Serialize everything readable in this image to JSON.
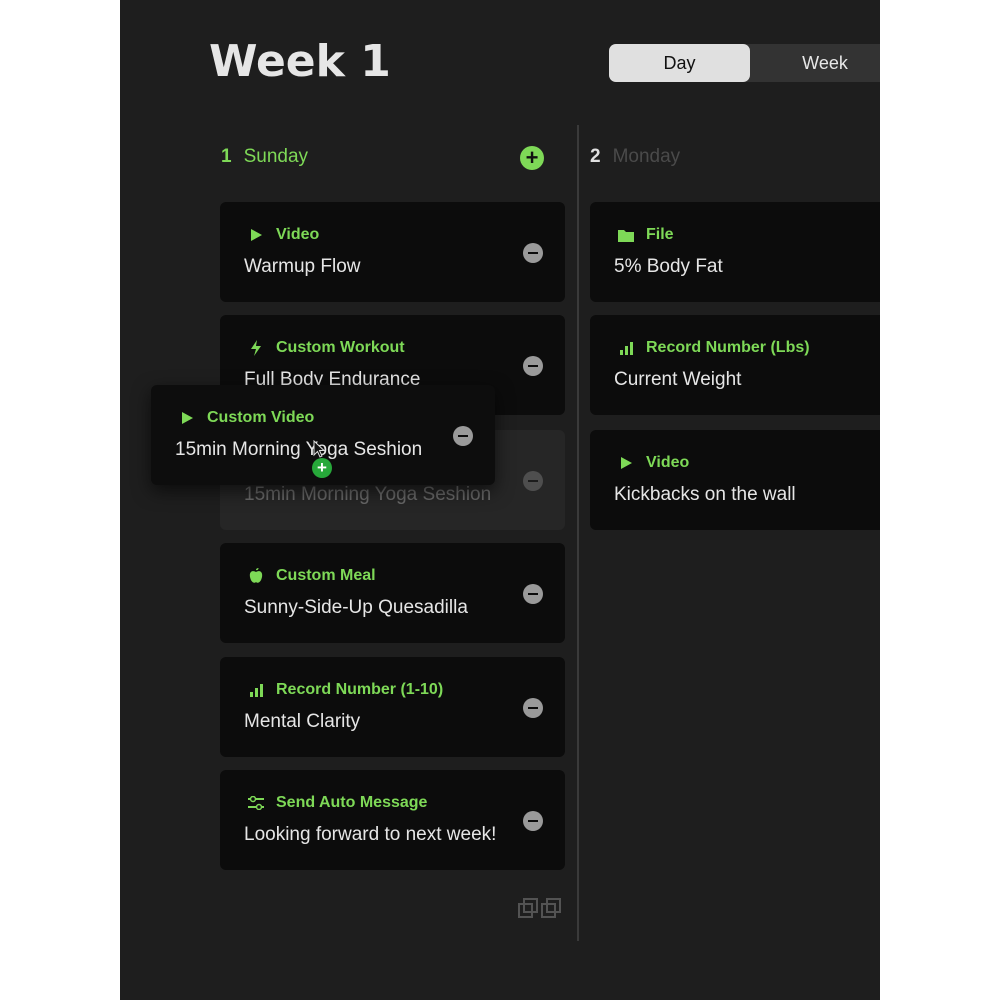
{
  "header": {
    "title": "Week 1"
  },
  "view_toggle": {
    "day": "Day",
    "week": "Week"
  },
  "days": [
    {
      "num": "1",
      "name": "Sunday"
    },
    {
      "num": "2",
      "name": "Monday"
    }
  ],
  "sunday_cards": [
    {
      "type": "Video",
      "icon": "play-icon",
      "label": "Warmup Flow"
    },
    {
      "type": "Custom Workout",
      "icon": "lightning-icon",
      "label": "Full Body Endurance"
    },
    {
      "type": "Custom Video",
      "icon": "play-icon",
      "label": "15min Morning Yoga Seshion"
    },
    {
      "type": "Custom Meal",
      "icon": "apple-icon",
      "label": "Sunny-Side-Up Quesadilla"
    },
    {
      "type": "Record Number (1-10)",
      "icon": "bar-chart-icon",
      "label": "Mental Clarity"
    },
    {
      "type": "Send Auto Message",
      "icon": "sliders-icon",
      "label": "Looking forward to next week!"
    }
  ],
  "monday_cards": [
    {
      "type": "File",
      "icon": "folder-icon",
      "label": "5% Body Fat"
    },
    {
      "type": "Record Number (Lbs)",
      "icon": "bar-chart-icon",
      "label": "Current Weight"
    },
    {
      "type": "Video",
      "icon": "play-icon",
      "label": "Kickbacks on the wall"
    }
  ],
  "dragging_card": {
    "type": "Custom Video",
    "icon": "play-icon",
    "label": "15min Morning Yoga Seshion"
  },
  "colors": {
    "accent": "#7ed957",
    "background": "#1e1e1e",
    "card": "#0c0c0c"
  }
}
